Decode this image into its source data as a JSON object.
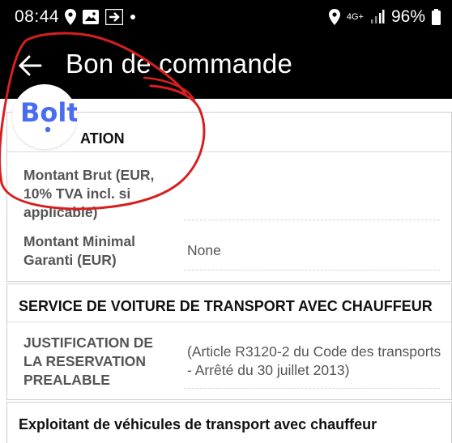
{
  "status_bar": {
    "time": "08:44",
    "battery": "96%",
    "network": "4G+"
  },
  "app_bar": {
    "title": "Bon de commande"
  },
  "brand": {
    "logo_text": "Bolt",
    "color": "#4a6cf0"
  },
  "section_tarification": {
    "header_visible": "ATION",
    "rows": [
      {
        "label": "Montant Brut (EUR, 10% TVA incl. si applicable)",
        "value": ""
      },
      {
        "label": "Montant Minimal Garanti (EUR)",
        "value": "None"
      }
    ]
  },
  "section_vtc": {
    "header": "SERVICE DE VOITURE DE TRANSPORT AVEC CHAUFFEUR",
    "rows": [
      {
        "label": "JUSTIFICATION DE LA RESERVATION PREALABLE",
        "value": "(Article R3120-2 du Code des transports - Arrêté du 30 juillet 2013)"
      }
    ]
  },
  "section_exploitant": {
    "header": "Exploitant de véhicules de transport avec chauffeur"
  },
  "colors": {
    "annotation": "#d81f1f",
    "bar_background": "#000000"
  }
}
